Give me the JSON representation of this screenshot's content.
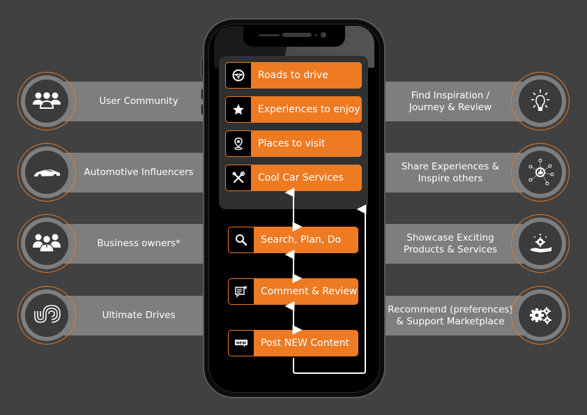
{
  "left_audiences": [
    {
      "label": "User Community",
      "icon": "user-community-icon"
    },
    {
      "label": "Automotive Influencers",
      "icon": "sports-car-icon"
    },
    {
      "label": "Business owners*",
      "icon": "business-owners-icon"
    },
    {
      "label": "Ultimate Drives",
      "icon": "ultimate-drives-logo-icon"
    }
  ],
  "right_benefits": [
    {
      "line1": "Find Inspiration /",
      "line2": "Journey & Review",
      "icon": "lightbulb-icon"
    },
    {
      "line1": "Share Experiences &",
      "line2": "Inspire others",
      "icon": "social-share-icon"
    },
    {
      "line1": "Showcase Exciting",
      "line2": "Products & Services",
      "icon": "hand-gear-icon"
    },
    {
      "line1": "Recommend (preferences)",
      "line2": "& Support Marketplace",
      "icon": "gears-icon"
    }
  ],
  "phone_menu": [
    {
      "label": "Roads to drive",
      "icon": "steering-wheel-icon"
    },
    {
      "label": "Experiences to enjoy",
      "icon": "star-icon"
    },
    {
      "label": "Places to visit",
      "icon": "map-pin-icon"
    },
    {
      "label": "Cool Car Services",
      "icon": "tools-icon"
    }
  ],
  "phone_flow": [
    {
      "label": "Search, Plan, Do",
      "icon": "search-icon"
    },
    {
      "label": "Comment & Review",
      "icon": "comment-star-icon"
    },
    {
      "label": "Post NEW Content",
      "icon": "new-badge-icon",
      "badge_text": "NEW"
    }
  ],
  "colors": {
    "accent": "#ee7a22",
    "background": "#414141",
    "band": "#7e7e7e"
  }
}
